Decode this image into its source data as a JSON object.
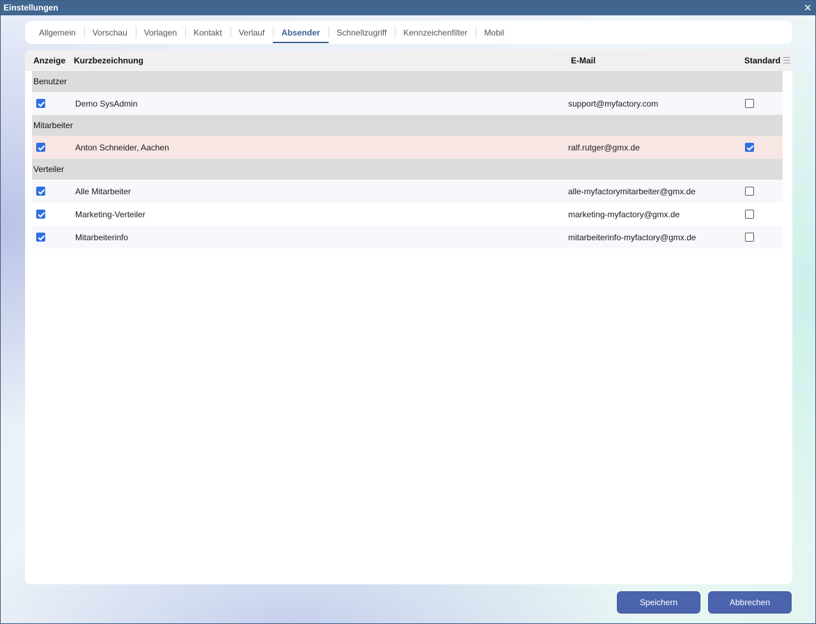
{
  "window": {
    "title": "Einstellungen"
  },
  "tabs": [
    {
      "label": "Allgemein"
    },
    {
      "label": "Vorschau"
    },
    {
      "label": "Vorlagen"
    },
    {
      "label": "Kontakt"
    },
    {
      "label": "Verlauf"
    },
    {
      "label": "Absender",
      "active": true
    },
    {
      "label": "Schnellzugriff"
    },
    {
      "label": "Kennzeichenfilter"
    },
    {
      "label": "Mobil"
    }
  ],
  "grid": {
    "columns": {
      "anzeige": "Anzeige",
      "kurzbezeichnung": "Kurzbezeichnung",
      "email": "E-Mail",
      "standard": "Standard"
    },
    "groups": [
      {
        "name": "Benutzer",
        "rows": [
          {
            "anzeige": true,
            "kurzbezeichnung": "Demo SysAdmin",
            "email": "support@myfactory.com",
            "standard": false
          }
        ]
      },
      {
        "name": "Mitarbeiter",
        "rows": [
          {
            "anzeige": true,
            "kurzbezeichnung": "Anton Schneider, Aachen",
            "email": "ralf.rutger@gmx.de",
            "standard": true,
            "selected": true
          }
        ]
      },
      {
        "name": "Verteiler",
        "rows": [
          {
            "anzeige": true,
            "kurzbezeichnung": "Alle Mitarbeiter",
            "email": "alle-myfactorymitarbeiter@gmx.de",
            "standard": false
          },
          {
            "anzeige": true,
            "kurzbezeichnung": "Marketing-Verteiler",
            "email": "marketing-myfactory@gmx.de",
            "standard": false
          },
          {
            "anzeige": true,
            "kurzbezeichnung": "Mitarbeiterinfo",
            "email": "mitarbeiterinfo-myfactory@gmx.de",
            "standard": false
          }
        ]
      }
    ]
  },
  "buttons": {
    "save": "Speichern",
    "cancel": "Abbrechen"
  },
  "icons": {
    "close": "close-icon",
    "column_menu": "menu-icon"
  },
  "colors": {
    "titlebar": "#41668f",
    "accent": "#3d5f8f",
    "button": "#4b64ad",
    "checkbox": "#2f6fe0",
    "selected_row": "#f7e6e4",
    "group_row": "#dcdcdc"
  }
}
